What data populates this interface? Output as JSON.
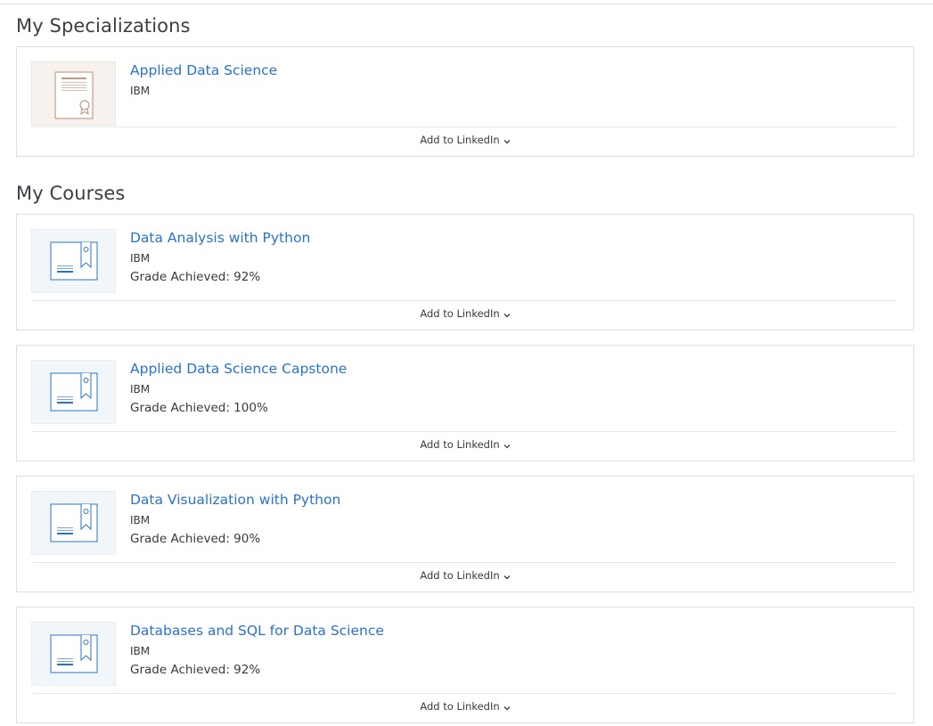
{
  "specializations": {
    "heading": "My Specializations",
    "items": [
      {
        "title": "Applied Data Science",
        "org": "IBM",
        "action": "Add to LinkedIn",
        "icon": "certificate-icon"
      }
    ]
  },
  "courses": {
    "heading": "My Courses",
    "items": [
      {
        "title": "Data Analysis with Python",
        "org": "IBM",
        "grade": "Grade Achieved: 92%",
        "action": "Add to LinkedIn",
        "icon": "course-certificate-icon"
      },
      {
        "title": "Applied Data Science Capstone",
        "org": "IBM",
        "grade": "Grade Achieved: 100%",
        "action": "Add to LinkedIn",
        "icon": "course-certificate-icon"
      },
      {
        "title": "Data Visualization with Python",
        "org": "IBM",
        "grade": "Grade Achieved: 90%",
        "action": "Add to LinkedIn",
        "icon": "course-certificate-icon"
      },
      {
        "title": "Databases and SQL for Data Science",
        "org": "IBM",
        "grade": "Grade Achieved: 92%",
        "action": "Add to LinkedIn",
        "icon": "course-certificate-icon"
      }
    ]
  },
  "colors": {
    "link": "#2a73cc",
    "text": "#373a3c",
    "border": "#dedede"
  }
}
